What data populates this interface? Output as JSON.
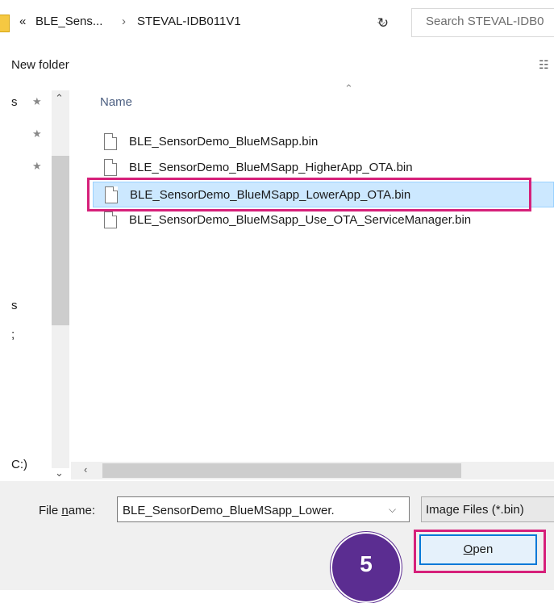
{
  "address_bar": {
    "prev_crumbs": "«",
    "crumb1": "BLE_Sens...",
    "sep": "›",
    "crumb2": "STEVAL-IDB011V1",
    "dropdown_icon": "chevron-down-icon",
    "refresh_icon": "refresh-icon",
    "refresh_glyph": "↻",
    "search_placeholder": "Search STEVAL-IDB0"
  },
  "toolbar": {
    "new_folder": "New folder",
    "view_icon": "view-options-icon"
  },
  "nav_pane": {
    "items": [
      {
        "label": "s",
        "pinned": true
      },
      {
        "label": "",
        "pinned": true
      },
      {
        "label": "",
        "pinned": true
      },
      {
        "label": "s",
        "pinned": false
      },
      {
        "label": ";",
        "pinned": false
      },
      {
        "label": "C:)",
        "pinned": false
      }
    ]
  },
  "file_list": {
    "column_name": "Name",
    "files": [
      {
        "name": "BLE_SensorDemo_BlueMSapp.bin",
        "selected": false
      },
      {
        "name": "BLE_SensorDemo_BlueMSapp_HigherApp_OTA.bin",
        "selected": false
      },
      {
        "name": "BLE_SensorDemo_BlueMSapp_LowerApp_OTA.bin",
        "selected": true
      },
      {
        "name": "BLE_SensorDemo_BlueMSapp_Use_OTA_ServiceManager.bin",
        "selected": false
      }
    ]
  },
  "bottom": {
    "file_name_label_pre": "File ",
    "file_name_label_u": "n",
    "file_name_label_post": "ame:",
    "file_name_value": "BLE_SensorDemo_BlueMSapp_Lower.",
    "filter": "Image Files (*.bin)",
    "open_u": "O",
    "open_rest": "pen"
  },
  "annotation": {
    "step_number": "5"
  },
  "colors": {
    "highlight": "#d6207a",
    "step_badge": "#5b2d91",
    "selection": "#cce8ff"
  }
}
